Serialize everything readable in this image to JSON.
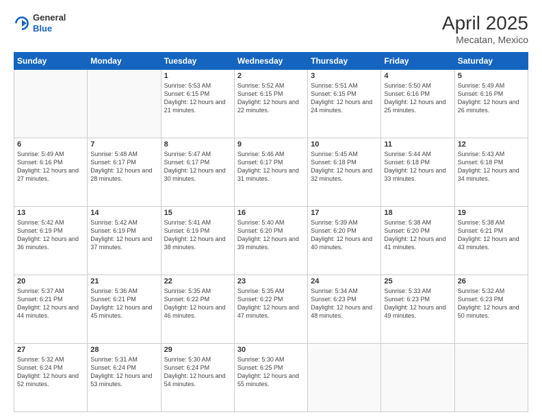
{
  "header": {
    "logo_general": "General",
    "logo_blue": "Blue",
    "month_year": "April 2025",
    "location": "Mecatan, Mexico"
  },
  "days_of_week": [
    "Sunday",
    "Monday",
    "Tuesday",
    "Wednesday",
    "Thursday",
    "Friday",
    "Saturday"
  ],
  "weeks": [
    [
      {
        "day": "",
        "info": ""
      },
      {
        "day": "",
        "info": ""
      },
      {
        "day": "1",
        "info": "Sunrise: 5:53 AM\nSunset: 6:15 PM\nDaylight: 12 hours and 21 minutes."
      },
      {
        "day": "2",
        "info": "Sunrise: 5:52 AM\nSunset: 6:15 PM\nDaylight: 12 hours and 22 minutes."
      },
      {
        "day": "3",
        "info": "Sunrise: 5:51 AM\nSunset: 6:15 PM\nDaylight: 12 hours and 24 minutes."
      },
      {
        "day": "4",
        "info": "Sunrise: 5:50 AM\nSunset: 6:16 PM\nDaylight: 12 hours and 25 minutes."
      },
      {
        "day": "5",
        "info": "Sunrise: 5:49 AM\nSunset: 6:16 PM\nDaylight: 12 hours and 26 minutes."
      }
    ],
    [
      {
        "day": "6",
        "info": "Sunrise: 5:49 AM\nSunset: 6:16 PM\nDaylight: 12 hours and 27 minutes."
      },
      {
        "day": "7",
        "info": "Sunrise: 5:48 AM\nSunset: 6:17 PM\nDaylight: 12 hours and 28 minutes."
      },
      {
        "day": "8",
        "info": "Sunrise: 5:47 AM\nSunset: 6:17 PM\nDaylight: 12 hours and 30 minutes."
      },
      {
        "day": "9",
        "info": "Sunrise: 5:46 AM\nSunset: 6:17 PM\nDaylight: 12 hours and 31 minutes."
      },
      {
        "day": "10",
        "info": "Sunrise: 5:45 AM\nSunset: 6:18 PM\nDaylight: 12 hours and 32 minutes."
      },
      {
        "day": "11",
        "info": "Sunrise: 5:44 AM\nSunset: 6:18 PM\nDaylight: 12 hours and 33 minutes."
      },
      {
        "day": "12",
        "info": "Sunrise: 5:43 AM\nSunset: 6:18 PM\nDaylight: 12 hours and 34 minutes."
      }
    ],
    [
      {
        "day": "13",
        "info": "Sunrise: 5:42 AM\nSunset: 6:19 PM\nDaylight: 12 hours and 36 minutes."
      },
      {
        "day": "14",
        "info": "Sunrise: 5:42 AM\nSunset: 6:19 PM\nDaylight: 12 hours and 37 minutes."
      },
      {
        "day": "15",
        "info": "Sunrise: 5:41 AM\nSunset: 6:19 PM\nDaylight: 12 hours and 38 minutes."
      },
      {
        "day": "16",
        "info": "Sunrise: 5:40 AM\nSunset: 6:20 PM\nDaylight: 12 hours and 39 minutes."
      },
      {
        "day": "17",
        "info": "Sunrise: 5:39 AM\nSunset: 6:20 PM\nDaylight: 12 hours and 40 minutes."
      },
      {
        "day": "18",
        "info": "Sunrise: 5:38 AM\nSunset: 6:20 PM\nDaylight: 12 hours and 41 minutes."
      },
      {
        "day": "19",
        "info": "Sunrise: 5:38 AM\nSunset: 6:21 PM\nDaylight: 12 hours and 43 minutes."
      }
    ],
    [
      {
        "day": "20",
        "info": "Sunrise: 5:37 AM\nSunset: 6:21 PM\nDaylight: 12 hours and 44 minutes."
      },
      {
        "day": "21",
        "info": "Sunrise: 5:36 AM\nSunset: 6:21 PM\nDaylight: 12 hours and 45 minutes."
      },
      {
        "day": "22",
        "info": "Sunrise: 5:35 AM\nSunset: 6:22 PM\nDaylight: 12 hours and 46 minutes."
      },
      {
        "day": "23",
        "info": "Sunrise: 5:35 AM\nSunset: 6:22 PM\nDaylight: 12 hours and 47 minutes."
      },
      {
        "day": "24",
        "info": "Sunrise: 5:34 AM\nSunset: 6:23 PM\nDaylight: 12 hours and 48 minutes."
      },
      {
        "day": "25",
        "info": "Sunrise: 5:33 AM\nSunset: 6:23 PM\nDaylight: 12 hours and 49 minutes."
      },
      {
        "day": "26",
        "info": "Sunrise: 5:32 AM\nSunset: 6:23 PM\nDaylight: 12 hours and 50 minutes."
      }
    ],
    [
      {
        "day": "27",
        "info": "Sunrise: 5:32 AM\nSunset: 6:24 PM\nDaylight: 12 hours and 52 minutes."
      },
      {
        "day": "28",
        "info": "Sunrise: 5:31 AM\nSunset: 6:24 PM\nDaylight: 12 hours and 53 minutes."
      },
      {
        "day": "29",
        "info": "Sunrise: 5:30 AM\nSunset: 6:24 PM\nDaylight: 12 hours and 54 minutes."
      },
      {
        "day": "30",
        "info": "Sunrise: 5:30 AM\nSunset: 6:25 PM\nDaylight: 12 hours and 55 minutes."
      },
      {
        "day": "",
        "info": ""
      },
      {
        "day": "",
        "info": ""
      },
      {
        "day": "",
        "info": ""
      }
    ]
  ]
}
